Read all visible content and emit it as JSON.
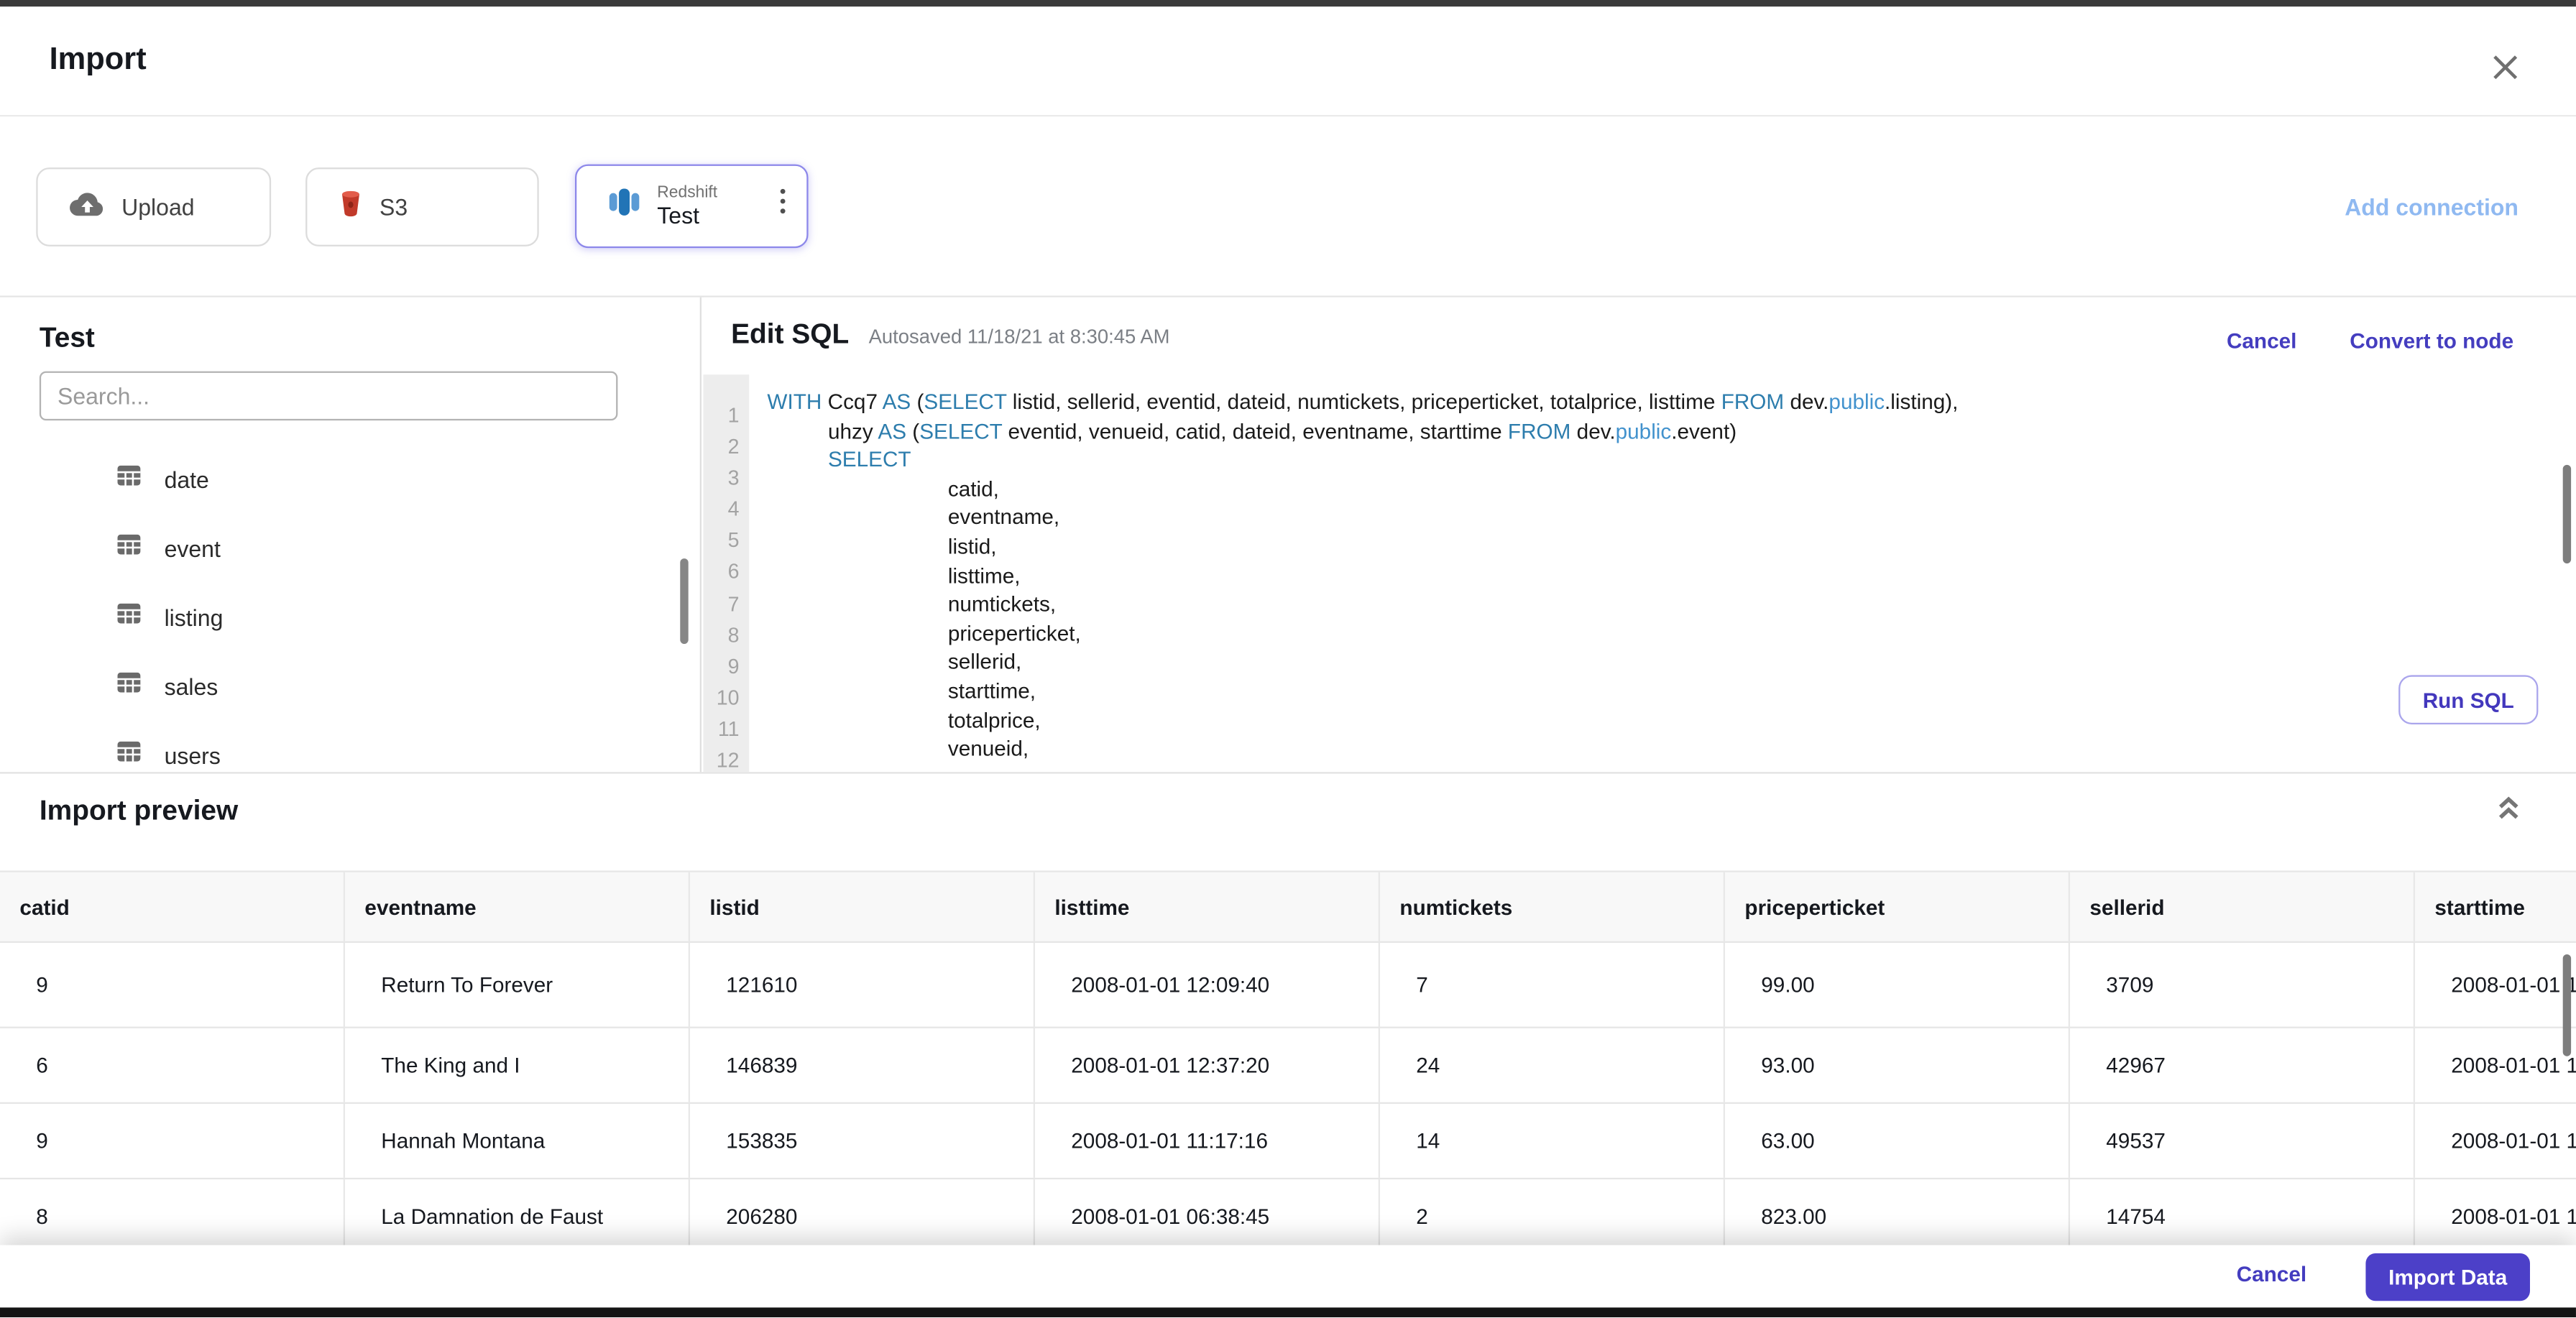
{
  "header": {
    "title": "Import"
  },
  "connections": {
    "tabs": [
      {
        "label": "Upload",
        "icon": "cloud-upload-icon"
      },
      {
        "label": "S3",
        "icon": "s3-icon"
      },
      {
        "type_label": "Redshift",
        "label": "Test",
        "icon": "redshift-icon",
        "selected": true
      }
    ],
    "add_label": "Add connection"
  },
  "sidebar": {
    "title": "Test",
    "search_placeholder": "Search...",
    "tables": [
      "date",
      "event",
      "listing",
      "sales",
      "users"
    ]
  },
  "editor": {
    "title": "Edit SQL",
    "autosaved": "Autosaved 11/18/21 at 8:30:45 AM",
    "cancel_label": "Cancel",
    "convert_label": "Convert to node",
    "run_label": "Run SQL",
    "line_numbers": [
      1,
      2,
      3,
      4,
      5,
      6,
      7,
      8,
      9,
      10,
      11,
      12
    ],
    "code_lines": [
      {
        "indent": 0,
        "tokens": [
          [
            "kw",
            "WITH"
          ],
          [
            "t",
            " Ccq7 "
          ],
          [
            "kw",
            "AS"
          ],
          [
            "t",
            " ("
          ],
          [
            "kw",
            "SELECT"
          ],
          [
            "t",
            " listid, sellerid, eventid, dateid, numtickets, priceperticket, totalprice, listtime "
          ],
          [
            "kw",
            "FROM"
          ],
          [
            "t",
            " dev."
          ],
          [
            "kw2",
            "public"
          ],
          [
            "t",
            ".listing),"
          ]
        ]
      },
      {
        "indent": 1,
        "tokens": [
          [
            "t",
            "uhzy "
          ],
          [
            "kw",
            "AS"
          ],
          [
            "t",
            " ("
          ],
          [
            "kw",
            "SELECT"
          ],
          [
            "t",
            " eventid, venueid, catid, dateid, eventname, starttime "
          ],
          [
            "kw",
            "FROM"
          ],
          [
            "t",
            " dev."
          ],
          [
            "kw2",
            "public"
          ],
          [
            "t",
            ".event)"
          ]
        ]
      },
      {
        "indent": 1,
        "tokens": [
          [
            "kw",
            "SELECT"
          ]
        ]
      },
      {
        "indent": 2,
        "tokens": [
          [
            "t",
            "catid,"
          ]
        ]
      },
      {
        "indent": 2,
        "tokens": [
          [
            "t",
            "eventname,"
          ]
        ]
      },
      {
        "indent": 2,
        "tokens": [
          [
            "t",
            "listid,"
          ]
        ]
      },
      {
        "indent": 2,
        "tokens": [
          [
            "t",
            "listtime,"
          ]
        ]
      },
      {
        "indent": 2,
        "tokens": [
          [
            "t",
            "numtickets,"
          ]
        ]
      },
      {
        "indent": 2,
        "tokens": [
          [
            "t",
            "priceperticket,"
          ]
        ]
      },
      {
        "indent": 2,
        "tokens": [
          [
            "t",
            "sellerid,"
          ]
        ]
      },
      {
        "indent": 2,
        "tokens": [
          [
            "t",
            "starttime,"
          ]
        ]
      },
      {
        "indent": 2,
        "tokens": [
          [
            "t",
            "totalprice,"
          ]
        ]
      },
      {
        "indent": 2,
        "tokens": [
          [
            "t",
            "venueid,"
          ]
        ]
      }
    ]
  },
  "preview": {
    "title": "Import preview",
    "columns": [
      "catid",
      "eventname",
      "listid",
      "listtime",
      "numtickets",
      "priceperticket",
      "sellerid",
      "starttime"
    ],
    "rows": [
      [
        "9",
        "Return To Forever",
        "121610",
        "2008-01-01 12:09:40",
        "7",
        "99.00",
        "3709",
        "2008-01-01 1"
      ],
      [
        "6",
        "The King and I",
        "146839",
        "2008-01-01 12:37:20",
        "24",
        "93.00",
        "42967",
        "2008-01-01 1"
      ],
      [
        "9",
        "Hannah Montana",
        "153835",
        "2008-01-01 11:17:16",
        "14",
        "63.00",
        "49537",
        "2008-01-01 1"
      ],
      [
        "8",
        "La Damnation de Faust",
        "206280",
        "2008-01-01 06:38:45",
        "2",
        "823.00",
        "14754",
        "2008-01-01 1"
      ]
    ]
  },
  "footer": {
    "cancel_label": "Cancel",
    "import_label": "Import Data"
  },
  "colors": {
    "accent_link": "#443dbf",
    "accent_fill": "#4c40c8",
    "add_connection": "#8fb9f1",
    "sql_keyword": "#2d7dad",
    "sql_schema": "#4292cd",
    "selected_card_border": "#8d88ea",
    "table_header_bg": "#f8f8f8",
    "gutter_bg": "#ededed",
    "chrome_strip": "#3a3a3a"
  }
}
